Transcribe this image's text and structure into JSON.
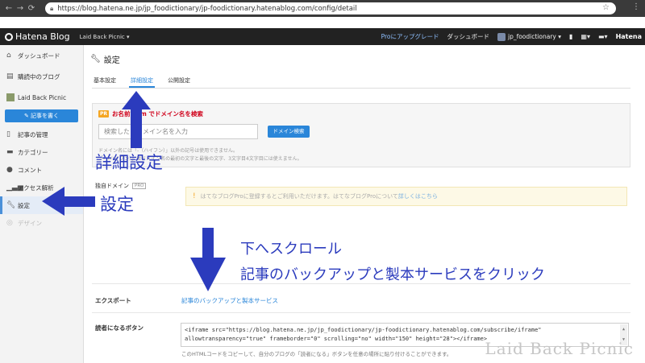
{
  "browser": {
    "url": "https://blog.hatena.ne.jp/jp_foodictionary/jp-foodictionary.hatenablog.com/config/detail"
  },
  "header": {
    "logo": "Hatena Blog",
    "blog_selector": "Laid Back Picnic ▾",
    "pro_upgrade": "Proにアップグレード",
    "dashboard": "ダッシュボード",
    "user": "jp_foodictionary ▾",
    "brand": "Hatena"
  },
  "sidebar": {
    "items": [
      {
        "label": "ダッシュボード"
      },
      {
        "label": "購読中のブログ"
      },
      {
        "label": "Laid Back Picnic"
      },
      {
        "label": "記事の管理"
      },
      {
        "label": "カテゴリー"
      },
      {
        "label": "コメント"
      },
      {
        "label": "アクセス解析"
      },
      {
        "label": "設定"
      },
      {
        "label": "デザイン"
      }
    ],
    "write_button": "記事を書く"
  },
  "main": {
    "title": "設定",
    "tabs": [
      {
        "label": "基本設定"
      },
      {
        "label": "詳細設定"
      },
      {
        "label": "公開設定"
      }
    ],
    "domain": {
      "pro_badge": "PR",
      "heading": "お名前.com でドメイン名を検索",
      "placeholder": "検索したいドメイン名を入力",
      "search_button": "ドメイン検索",
      "note1": "ドメイン名には「-（ハイフン）」以外の記号は使用できません。",
      "note2": "「-（ハイフン）」はドメイン名の最初の文字と最後の文字、3文字目4文字目には使えません。"
    },
    "own_domain": {
      "label": "独自ドメイン",
      "badge": "PRO",
      "warning": "はてなブログProに登録するとご利用いただけます。はてなブログProについて",
      "warning_link": "詳しくはこちら"
    },
    "export": {
      "label": "エクスポート",
      "link": "記事のバックアップと製本サービス"
    },
    "reader_button": {
      "label": "読者になるボタン",
      "code": "<iframe src=\"https://blog.hatena.ne.jp/jp_foodictionary/jp-foodictionary.hatenablog.com/subscribe/iframe\" allowtransparency=\"true\" frameborder=\"0\" scrolling=\"no\" width=\"150\" height=\"28\"></iframe>",
      "help": "このHTMLコードをコピーして、自分のブログの「読者になる」ボタンを任意の場所に貼り付けることができます。"
    }
  },
  "annotations": {
    "detail": "詳細設定",
    "settings": "設定",
    "scroll": "下へスクロール",
    "click": "記事のバックアップと製本サービスをクリック"
  },
  "watermark": "Laid Back Picnic",
  "colors": {
    "accent": "#2a86d9",
    "annotation": "#2b3bbd",
    "header_bg": "#222222",
    "pro_red": "#d0021b"
  }
}
